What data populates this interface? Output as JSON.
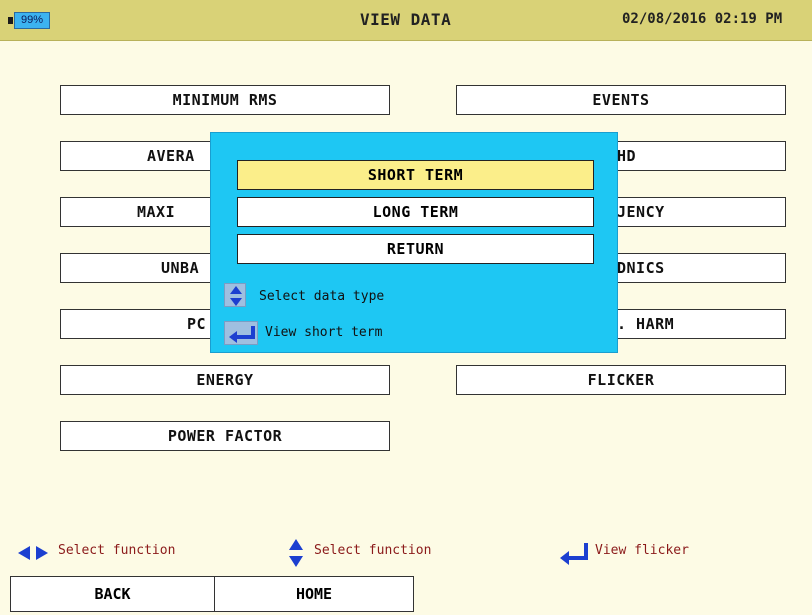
{
  "header": {
    "battery": "99%",
    "title": "VIEW DATA",
    "datetime": "02/08/2016 02:19 PM"
  },
  "menu": {
    "minimum_rms": "MINIMUM RMS",
    "events": "EVENTS",
    "average": "AVERA",
    "thd": "HD",
    "maximum": "MAXI",
    "frequency": "JENCY",
    "unbalance": "UNBA",
    "harmonics": "DNICS",
    "power": "PC",
    "harm": ". HARM",
    "energy": "ENERGY",
    "flicker": "FLICKER",
    "power_factor": "POWER FACTOR"
  },
  "dialog": {
    "options": [
      "SHORT TERM",
      "LONG TERM",
      "RETURN"
    ],
    "selected_index": 0,
    "hint_select": "Select data type",
    "hint_view": "View short term"
  },
  "footer": {
    "hint_left": "Select function",
    "hint_middle": "Select function",
    "hint_right": "View flicker",
    "softkeys": [
      "BACK",
      "HOME"
    ]
  },
  "colors": {
    "header_bg": "#d9d277",
    "page_bg": "#fdfbe5",
    "dialog_bg": "#1ec7f3",
    "selected_bg": "#fbee8a",
    "icon_blue": "#1c3fd0"
  }
}
